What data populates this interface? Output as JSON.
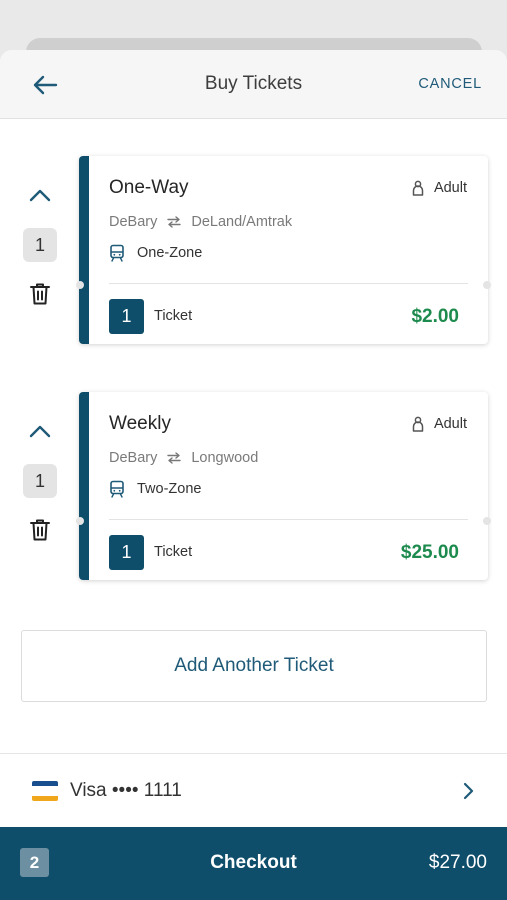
{
  "header": {
    "title": "Buy Tickets",
    "cancel_label": "CANCEL"
  },
  "tickets": [
    {
      "type": "One-Way",
      "rider": "Adult",
      "from": "DeBary",
      "to": "DeLand/Amtrak",
      "zone": "One-Zone",
      "quantity": "1",
      "ticket_label": "Ticket",
      "price": "$2.00"
    },
    {
      "type": "Weekly",
      "rider": "Adult",
      "from": "DeBary",
      "to": "Longwood",
      "zone": "Two-Zone",
      "quantity": "1",
      "ticket_label": "Ticket",
      "price": "$25.00"
    }
  ],
  "add_ticket_label": "Add Another Ticket",
  "payment": {
    "method": "Visa •••• 1111",
    "icon": "credit-card-icon"
  },
  "checkout": {
    "count": "2",
    "label": "Checkout",
    "total": "$27.00"
  },
  "colors": {
    "brand": "#0f4e6b",
    "price": "#1d8a4e",
    "link": "#1f5a78"
  }
}
